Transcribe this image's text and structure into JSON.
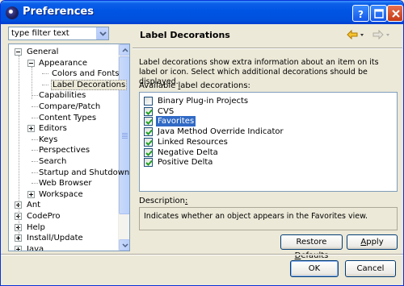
{
  "window": {
    "title": "Preferences"
  },
  "filter": {
    "value": "type filter text"
  },
  "tree": {
    "items": [
      {
        "label": "General",
        "level": 0,
        "expander": "minus"
      },
      {
        "label": "Appearance",
        "level": 1,
        "expander": "minus"
      },
      {
        "label": "Colors and Fonts",
        "level": 2,
        "expander": "none"
      },
      {
        "label": "Label Decorations",
        "level": 2,
        "expander": "none",
        "selected": true
      },
      {
        "label": "Capabilities",
        "level": 1,
        "expander": "none"
      },
      {
        "label": "Compare/Patch",
        "level": 1,
        "expander": "none"
      },
      {
        "label": "Content Types",
        "level": 1,
        "expander": "none"
      },
      {
        "label": "Editors",
        "level": 1,
        "expander": "plus"
      },
      {
        "label": "Keys",
        "level": 1,
        "expander": "none"
      },
      {
        "label": "Perspectives",
        "level": 1,
        "expander": "none"
      },
      {
        "label": "Search",
        "level": 1,
        "expander": "none"
      },
      {
        "label": "Startup and Shutdown",
        "level": 1,
        "expander": "none"
      },
      {
        "label": "Web Browser",
        "level": 1,
        "expander": "none"
      },
      {
        "label": "Workspace",
        "level": 1,
        "expander": "plus"
      },
      {
        "label": "Ant",
        "level": 0,
        "expander": "plus"
      },
      {
        "label": "CodePro",
        "level": 0,
        "expander": "plus"
      },
      {
        "label": "Help",
        "level": 0,
        "expander": "plus"
      },
      {
        "label": "Install/Update",
        "level": 0,
        "expander": "plus"
      },
      {
        "label": "Java",
        "level": 0,
        "expander": "plus"
      }
    ]
  },
  "page": {
    "title": "Label Decorations",
    "intro": "Label decorations show extra information about an item on its label or icon. Select which additional decorations should be displayed.",
    "available_label": {
      "before": "Available ",
      "mnemonic": "l",
      "after": "abel decorations:"
    },
    "decorations": [
      {
        "label": "Binary Plug-in Projects",
        "checked": false,
        "selected": false
      },
      {
        "label": "CVS",
        "checked": true,
        "selected": false
      },
      {
        "label": "Favorites",
        "checked": true,
        "selected": true
      },
      {
        "label": "Java Method Override Indicator",
        "checked": true,
        "selected": false
      },
      {
        "label": "Linked Resources",
        "checked": true,
        "selected": false
      },
      {
        "label": "Negative Delta",
        "checked": true,
        "selected": false
      },
      {
        "label": "Positive Delta",
        "checked": true,
        "selected": false
      }
    ],
    "description_label": {
      "before": "Description",
      "mnemonic": ":",
      "after": ""
    },
    "description_text": "Indicates whether an object appears in the Favorites view."
  },
  "buttons": {
    "restore_defaults": {
      "before": "Restore ",
      "mnemonic": "D",
      "after": "efaults"
    },
    "apply": {
      "before": "",
      "mnemonic": "A",
      "after": "pply"
    },
    "ok": "OK",
    "cancel": "Cancel"
  },
  "colors": {
    "selection": "#316ac5",
    "titlebar": "#0054e3",
    "nav_arrow": "#e0a000"
  }
}
